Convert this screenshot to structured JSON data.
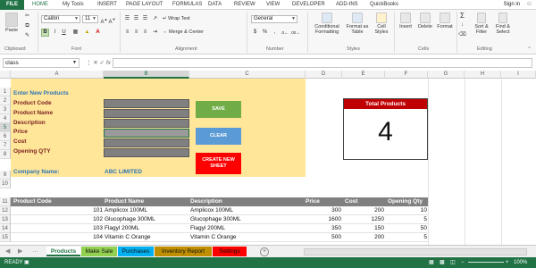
{
  "tabs": {
    "file": "FILE",
    "items": [
      "HOME",
      "My Tools",
      "INSERT",
      "PAGE LAYOUT",
      "FORMULAS",
      "DATA",
      "REVIEW",
      "VIEW",
      "DEVELOPER",
      "ADD-INS",
      "QuickBooks"
    ],
    "active": "HOME",
    "signin": "Sign in"
  },
  "ribbon": {
    "paste": "Paste",
    "clipboard": "Clipboard",
    "font_name": "Calibri",
    "font_size": "11",
    "font_group": "Font",
    "wrap_text": "Wrap Text",
    "merge_center": "Merge & Center",
    "alignment_group": "Alignment",
    "number_format": "General",
    "number_group": "Number",
    "conditional_formatting": "Conditional Formatting",
    "format_as_table": "Format as Table",
    "cell_styles": "Cell Styles",
    "styles_group": "Styles",
    "insert": "Insert",
    "delete": "Delete",
    "format": "Format",
    "cells_group": "Cells",
    "sort_filter": "Sort & Filter",
    "find_select": "Find & Select",
    "editing_group": "Editing"
  },
  "formula_bar": {
    "name_box": "class",
    "fx": "fx",
    "formula": ""
  },
  "grid": {
    "columns": [
      "A",
      "B",
      "C",
      "D",
      "E",
      "F",
      "G",
      "H",
      "I"
    ],
    "selected_column": "B",
    "rows": [
      "1",
      "2",
      "3",
      "4",
      "5",
      "6",
      "7",
      "8",
      "9",
      "10",
      "11",
      "12",
      "13",
      "14",
      "15"
    ],
    "selected_row": "5"
  },
  "form": {
    "title": "Enter New Products",
    "fields": [
      "Product Code",
      "Product Name",
      "Description",
      "Price",
      "Cost",
      "Opening QTY"
    ],
    "company_label": "Company Name:",
    "company_value": "ABC LIMITED",
    "save_label": "SAVE",
    "clear_label": "CLEAR",
    "create_sheet_label": "CREATE NEW SHEET"
  },
  "summary": {
    "title": "Total Products",
    "value": "4"
  },
  "table": {
    "headers": [
      "Product Code",
      "Product Name",
      "Description",
      "Price",
      "Cost",
      "Opening Qty"
    ],
    "rows": [
      [
        "101",
        "Amplicox 100ML",
        "Amplicox 100ML",
        "300",
        "200",
        "10"
      ],
      [
        "102",
        "Glucophage 300ML",
        "Glucophage 300ML",
        "1600",
        "1250",
        "5"
      ],
      [
        "103",
        "Flagyl 200ML",
        "Flagyl 200ML",
        "350",
        "150",
        "50"
      ],
      [
        "104",
        "Vitamin C Orange",
        "Vitamin C Orange",
        "500",
        "200",
        "5"
      ]
    ]
  },
  "sheet_tabs": [
    {
      "label": "Products",
      "color": "#ffffff",
      "active": true
    },
    {
      "label": "Make Sale",
      "color": "#92d050",
      "active": false
    },
    {
      "label": "Purchases",
      "color": "#00b0f0",
      "active": false
    },
    {
      "label": "Inventory Report",
      "color": "#bf8f00",
      "active": false
    },
    {
      "label": "Settings",
      "color": "#ff0000",
      "active": false
    }
  ],
  "status": {
    "mode": "READY",
    "zoom": "100%"
  },
  "colors": {
    "excel_green": "#217346",
    "save_button": "#70ad47",
    "clear_button": "#5b9bd5",
    "create_button": "#ff0000",
    "summary_header": "#c00000",
    "form_background": "#ffe699"
  }
}
